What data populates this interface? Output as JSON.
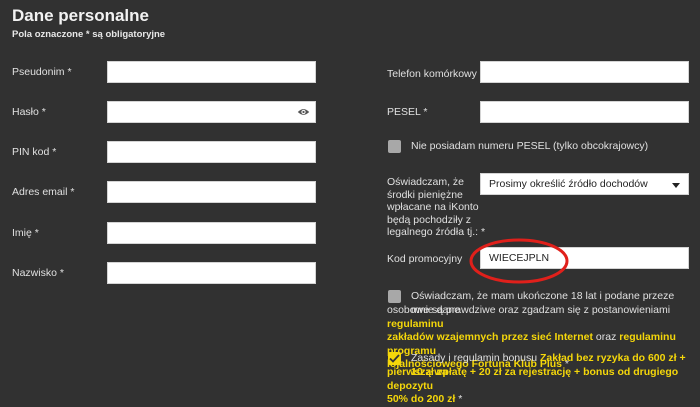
{
  "header": {
    "title": "Dane personalne",
    "subtitle": "Pola oznaczone * są obligatoryjne"
  },
  "left": {
    "pseudonim": {
      "label": "Pseudonim *",
      "value": ""
    },
    "haslo": {
      "label": "Hasło *",
      "value": ""
    },
    "pin": {
      "label": "PIN kod *",
      "value": ""
    },
    "email": {
      "label": "Adres email *",
      "value": ""
    },
    "imie": {
      "label": "Imię *",
      "value": ""
    },
    "nazwisko": {
      "label": "Nazwisko *",
      "value": ""
    }
  },
  "right": {
    "telefon": {
      "label": "Telefon komórkowy *",
      "value": ""
    },
    "pesel": {
      "label": "PESEL *",
      "value": ""
    },
    "no_pesel": {
      "label": "Nie posiadam numeru PESEL (tylko obcokrajowcy)",
      "checked": false
    },
    "source": {
      "label_lines": [
        "Oświadczam, że",
        "środki pieniężne",
        "wpłacane na iKonto",
        "będą pochodziły z",
        "legalnego źródła tj.: *"
      ],
      "selected": "Prosimy określić źródło dochodów"
    },
    "promo": {
      "label": "Kod promocyjny",
      "value": "WIECEJPLN"
    }
  },
  "consent": {
    "checked": false,
    "line1": "Oświadczam, że mam ukończone 18 lat i podane przeze mnie dane",
    "line2_pre": "osobowe są prawdziwe oraz zgadzam się z postanowieniami ",
    "link1_a": "regulaminu",
    "link1_b": "zakładów wzajemnych przez sieć Internet",
    "mid": " oraz ",
    "link2_a": "regulaminu programu",
    "link2_b": "lojalnościowego Fortuna Klub Plus",
    "end": " *"
  },
  "bonus": {
    "checked": true,
    "pre": "Zasady i regulamin bonusu ",
    "bold1": "Zakład bez ryzyka do 600 zł + 10 zł za",
    "bold2": "pierwszą wpłatę + 20 zł za rejestrację + bonus od drugiego depozytu",
    "bold3": "50% do 200 zł",
    "end": " *"
  },
  "colors": {
    "background": "#313131",
    "accent": "#f5d70a",
    "highlight_circle": "#e0201b"
  }
}
